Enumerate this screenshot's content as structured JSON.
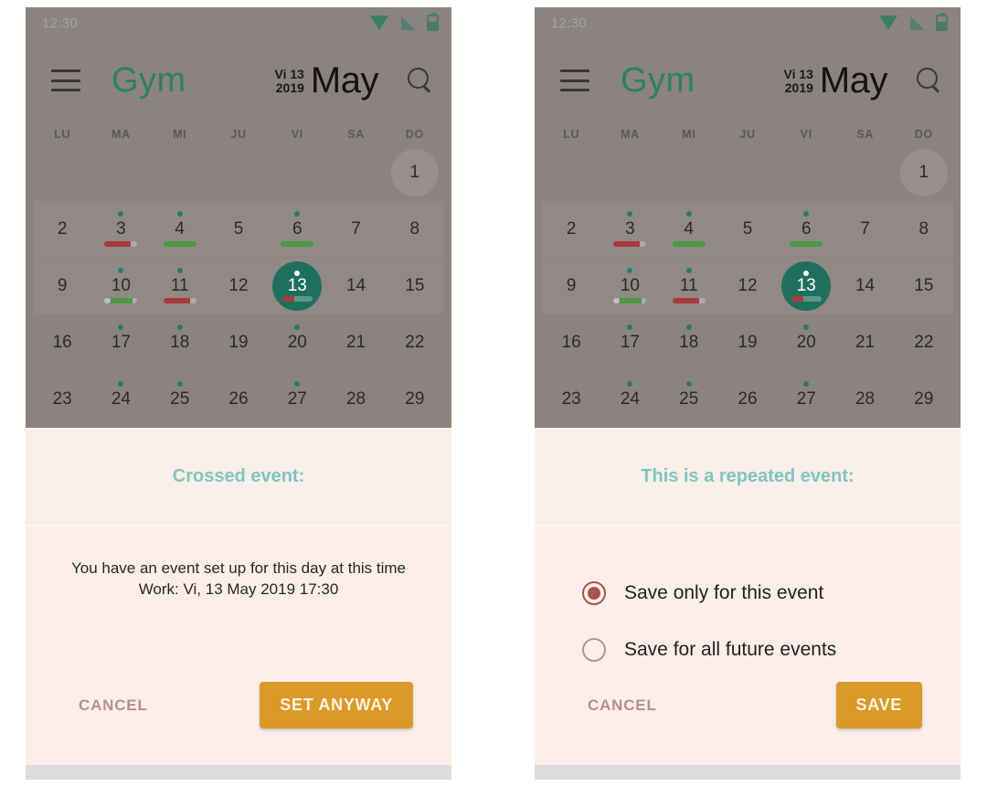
{
  "statusbar": {
    "time": "12:30",
    "icons": [
      "wifi-icon",
      "signal-icon",
      "battery-icon"
    ]
  },
  "appbar": {
    "menu_icon": "hamburger-menu-icon",
    "title": "Gym",
    "date_line1": "Vi 13",
    "date_line2": "2019",
    "month": "May",
    "search_icon": "search-icon"
  },
  "calendar": {
    "weekday_headers": [
      "LU",
      "MA",
      "MI",
      "JU",
      "VI",
      "SA",
      "DO"
    ],
    "weeks": [
      {
        "shaded": false,
        "days": [
          {
            "num": "",
            "empty": true
          },
          {
            "num": "",
            "empty": true
          },
          {
            "num": "",
            "empty": true
          },
          {
            "num": "",
            "empty": true
          },
          {
            "num": "",
            "empty": true
          },
          {
            "num": "",
            "empty": true
          },
          {
            "num": "1",
            "today": true
          }
        ]
      },
      {
        "shaded": true,
        "days": [
          {
            "num": "2"
          },
          {
            "num": "3",
            "dot": "green",
            "bar": {
              "color": "red",
              "fill": 78
            }
          },
          {
            "num": "4",
            "dot": "green",
            "bar": {
              "color": "green",
              "fill": 100
            }
          },
          {
            "num": "5"
          },
          {
            "num": "6",
            "dot": "green",
            "bar": {
              "color": "green",
              "fill": 100
            }
          },
          {
            "num": "7"
          },
          {
            "num": "8"
          }
        ]
      },
      {
        "shaded": true,
        "days": [
          {
            "num": "9"
          },
          {
            "num": "10",
            "dot": "teal",
            "bar": {
              "color": "green",
              "fill": 86,
              "cap": true
            }
          },
          {
            "num": "11",
            "dot": "green",
            "bar": {
              "color": "red",
              "fill": 82
            }
          },
          {
            "num": "12"
          },
          {
            "num": "13",
            "selected": true,
            "dot": "white",
            "bar": {
              "color": "red",
              "fill": 40
            }
          },
          {
            "num": "14"
          },
          {
            "num": "15"
          }
        ]
      },
      {
        "shaded": false,
        "days": [
          {
            "num": "16"
          },
          {
            "num": "17",
            "dot": "green"
          },
          {
            "num": "18",
            "dot": "green"
          },
          {
            "num": "19"
          },
          {
            "num": "20",
            "dot": "green"
          },
          {
            "num": "21"
          },
          {
            "num": "22"
          }
        ]
      },
      {
        "shaded": false,
        "days": [
          {
            "num": "23"
          },
          {
            "num": "24",
            "dot": "green"
          },
          {
            "num": "25",
            "dot": "green"
          },
          {
            "num": "26"
          },
          {
            "num": "27",
            "dot": "green"
          },
          {
            "num": "28"
          },
          {
            "num": "29"
          }
        ]
      }
    ]
  },
  "dialog_left": {
    "title": "Crossed event:",
    "message_line1": "You have an event set up for this day at this time",
    "message_line2": "Work: Vi, 13 May 2019 17:30",
    "cancel_label": "CANCEL",
    "confirm_label": "SET ANYWAY"
  },
  "dialog_right": {
    "title": "This is a repeated event:",
    "options": [
      {
        "label": "Save only for this event",
        "checked": true
      },
      {
        "label": "Save for all future events",
        "checked": false
      }
    ],
    "cancel_label": "CANCEL",
    "confirm_label": "SAVE"
  },
  "colors": {
    "app_title": "#2e8067",
    "calendar_background": "#8b8380",
    "selected_day": "#1f6f5e",
    "sheet_background": "#fbeee8",
    "sheet_title": "#7fc6c1",
    "primary_button": "#d99a2a",
    "radio_checked": "#a8534e",
    "event_green": "#4a9a46",
    "event_red": "#a93a3f"
  }
}
